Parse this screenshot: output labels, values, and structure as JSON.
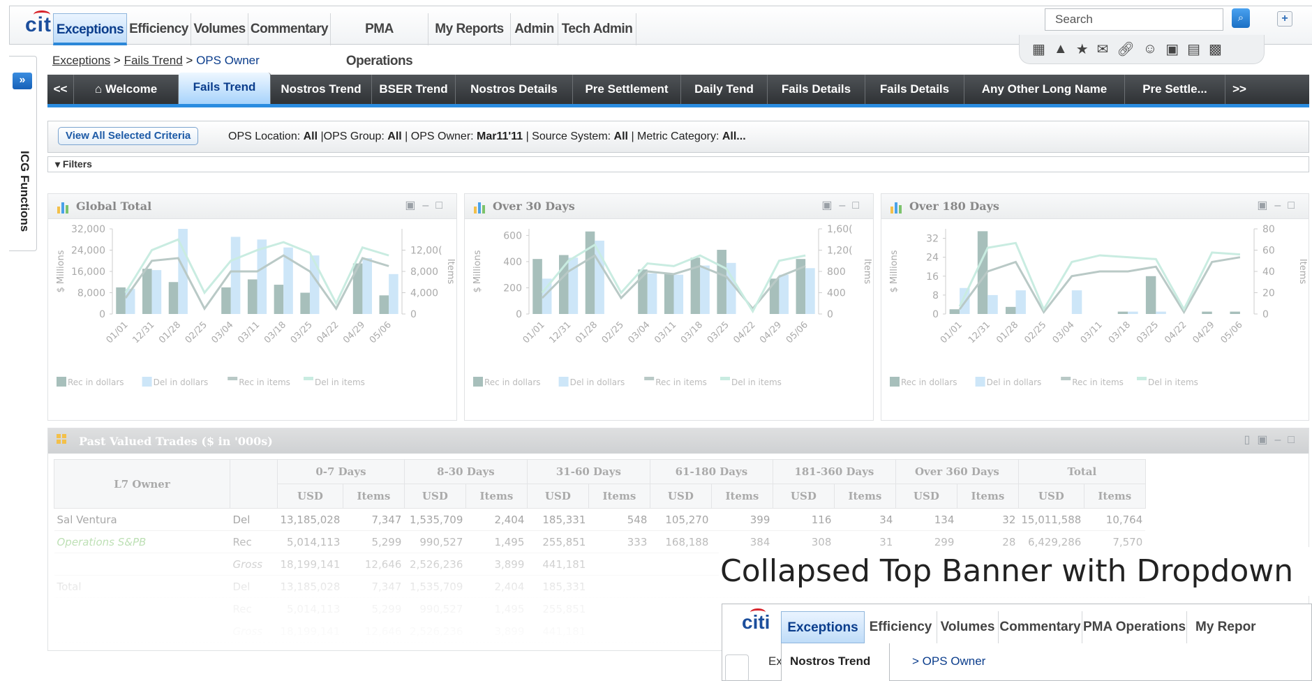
{
  "header": {
    "logo": "citi",
    "nav": [
      "Exceptions",
      "Efficiency",
      "Volumes",
      "Commentary",
      "PMA Operations",
      "My Reports",
      "Admin",
      "Tech Admin"
    ],
    "active_nav": "Exceptions",
    "search_placeholder": "Search",
    "tool_icons": [
      "grid-icon",
      "warning-icon",
      "star-icon",
      "mail-icon",
      "link-icon",
      "users-icon",
      "save-icon",
      "save-as-icon",
      "delete-icon"
    ]
  },
  "breadcrumb": {
    "items": [
      "Exceptions",
      "Fails Trend",
      "OPS Owner"
    ],
    "sep": ">"
  },
  "sidebar": {
    "label": "ICG Functions",
    "toggle": "»"
  },
  "subtabs": {
    "prev": "<<",
    "next": ">>",
    "items": [
      "Welcome",
      "Fails Trend",
      "Nostros Trend",
      "BSER Trend",
      "Nostros Details",
      "Pre Settlement",
      "Daily Tend",
      "Fails Details",
      "Fails Details",
      "Any  Other Long Name",
      "Pre Settle..."
    ],
    "active": "Fails Trend"
  },
  "criteria": {
    "button": "View All Selected Criteria",
    "parts": [
      {
        "label": "OPS Location: ",
        "value": "All"
      },
      {
        "label": " |OPS Group: ",
        "value": "All"
      },
      {
        "label": " |  OPS Owner: ",
        "value": "Mar11'11"
      },
      {
        "label": " |  Source System: ",
        "value": "All"
      },
      {
        "label": " |  Metric Category: ",
        "value": "All..."
      }
    ]
  },
  "filters": {
    "label": "Filters"
  },
  "chart_data": [
    {
      "type": "bar",
      "title": "Global Total",
      "ylabel": "$ Millions",
      "y2label": "Items",
      "categories": [
        "01/01",
        "12/31",
        "01/28",
        "02/25",
        "03/04",
        "03/11",
        "03/18",
        "03/25",
        "04/22",
        "04/29",
        "05/06"
      ],
      "ylim": [
        0,
        32000
      ],
      "yticks": [
        "0",
        "8,000",
        "16,000",
        "24,000",
        "32,000"
      ],
      "y2lim": [
        0,
        16000
      ],
      "y2ticks": [
        "0",
        "4,000",
        "8,000",
        "12,00("
      ],
      "series": [
        {
          "name": "Rec in dollars",
          "values": [
            10000,
            17000,
            12000,
            0,
            10000,
            13000,
            11000,
            8000,
            0,
            19000,
            7000
          ]
        },
        {
          "name": "Del in dollars",
          "values": [
            9500,
            16500,
            32000,
            0,
            29000,
            28000,
            25000,
            22000,
            0,
            21000,
            15000
          ]
        },
        {
          "name": "Rec in items",
          "values": [
            3000,
            10000,
            10500,
            1000,
            8000,
            8000,
            11000,
            8000,
            1000,
            10500,
            9000
          ]
        },
        {
          "name": "Del in items",
          "values": [
            4000,
            12000,
            14000,
            4000,
            10000,
            12000,
            13500,
            11500,
            2000,
            12500,
            11000
          ]
        }
      ]
    },
    {
      "type": "bar",
      "title": "Over 30 Days",
      "ylabel": "$ Millions",
      "y2label": "Items",
      "categories": [
        "01/01",
        "12/31",
        "01/28",
        "02/25",
        "03/04",
        "03/11",
        "03/18",
        "03/25",
        "04/22",
        "04/29",
        "05/06"
      ],
      "ylim": [
        0,
        650
      ],
      "yticks": [
        "0",
        "200",
        "400",
        "600"
      ],
      "y2lim": [
        0,
        1600
      ],
      "y2ticks": [
        "0",
        "400",
        "800",
        "1,20(",
        "1,60("
      ],
      "series": [
        {
          "name": "Rec in dollars",
          "values": [
            420,
            450,
            630,
            0,
            340,
            310,
            430,
            490,
            0,
            270,
            420
          ]
        },
        {
          "name": "Del in dollars",
          "values": [
            270,
            430,
            560,
            0,
            310,
            300,
            370,
            390,
            0,
            300,
            350
          ]
        },
        {
          "name": "Rec in items",
          "values": [
            300,
            800,
            1100,
            300,
            800,
            750,
            900,
            700,
            100,
            700,
            900
          ]
        },
        {
          "name": "Del in items",
          "values": [
            400,
            1000,
            1300,
            400,
            950,
            900,
            1100,
            850,
            50,
            1000,
            1100
          ]
        }
      ]
    },
    {
      "type": "bar",
      "title": "Over 180 Days",
      "ylabel": "$ Millions",
      "y2label": "Items",
      "categories": [
        "01/01",
        "12/31",
        "01/28",
        "02/25",
        "03/04",
        "03/11",
        "03/18",
        "03/25",
        "04/22",
        "04/29",
        "05/06"
      ],
      "ylim": [
        0,
        36
      ],
      "yticks": [
        "0",
        "8",
        "16",
        "24",
        "32"
      ],
      "y2lim": [
        0,
        90
      ],
      "y2ticks": [
        "0",
        "20",
        "40",
        "60",
        "80"
      ],
      "series": [
        {
          "name": "Rec in dollars",
          "values": [
            2,
            35,
            3,
            0,
            0,
            0,
            1,
            16,
            0,
            1,
            1
          ]
        },
        {
          "name": "Del in dollars",
          "values": [
            11,
            8,
            10,
            0,
            10,
            0,
            1,
            1,
            0,
            0,
            0
          ]
        },
        {
          "name": "Rec in items",
          "values": [
            5,
            45,
            55,
            2,
            40,
            45,
            45,
            50,
            2,
            55,
            60
          ]
        },
        {
          "name": "Del in items",
          "values": [
            8,
            70,
            75,
            5,
            55,
            62,
            60,
            58,
            5,
            65,
            63
          ]
        }
      ]
    }
  ],
  "table": {
    "title": "Past Valued Trades ($ in '000s)",
    "owner_header": "L7 Owner",
    "groups": [
      "0-7 Days",
      "8-30 Days",
      "31-60 Days",
      "61-180 Days",
      "181-360 Days",
      "Over 360 Days",
      "Total"
    ],
    "sub": [
      "USD",
      "Items"
    ],
    "rows": [
      [
        "Sal Ventura",
        "Del",
        "13,185,028",
        "7,347",
        "1,535,709",
        "2,404",
        "185,331",
        "548",
        "105,270",
        "399",
        "116",
        "34",
        "134",
        "32",
        "15,011,588",
        "10,764"
      ],
      [
        "Operations S&PB",
        "Rec",
        "5,014,113",
        "5,299",
        "990,527",
        "1,495",
        "255,851",
        "333",
        "168,188",
        "384",
        "308",
        "31",
        "299",
        "28",
        "6,429,286",
        "7,570"
      ],
      [
        "",
        "Gross",
        "18,199,141",
        "12,646",
        "2,526,236",
        "3,899",
        "441,181",
        "",
        "",
        "",
        "",
        "",
        "",
        "",
        "",
        ""
      ],
      [
        "Total",
        "Del",
        "13,185,028",
        "7,347",
        "1,535,709",
        "2,404",
        "185,331",
        "",
        "",
        "",
        "",
        "",
        "",
        "",
        "",
        ""
      ],
      [
        "",
        "Rec",
        "5,014,113",
        "5,299",
        "990,527",
        "1,495",
        "255,851",
        "",
        "",
        "",
        "",
        "",
        "",
        "",
        "",
        ""
      ],
      [
        "",
        "Gross",
        "18,199,141",
        "12,646",
        "2,526,236",
        "3,899",
        "441,181",
        "",
        "",
        "",
        "",
        "",
        "",
        "",
        "",
        ""
      ]
    ]
  },
  "overlay": {
    "caption": "Collapsed Top Banner with Dropdown",
    "logo": "citi",
    "nav": [
      "Exceptions",
      "Efficiency",
      "Volumes",
      "Commentary",
      "PMA Operations",
      "My Repor"
    ],
    "dropdown_item": "Nostros Trend",
    "crumb_start": "Ex",
    "crumb_end": "> OPS Owner"
  },
  "colors": {
    "rec_dollars": "#a7bfbb",
    "del_dollars": "#cde6f8",
    "rec_items": "#b9c9c6",
    "del_items": "#c9ece1",
    "accent": "#2b87d8"
  }
}
